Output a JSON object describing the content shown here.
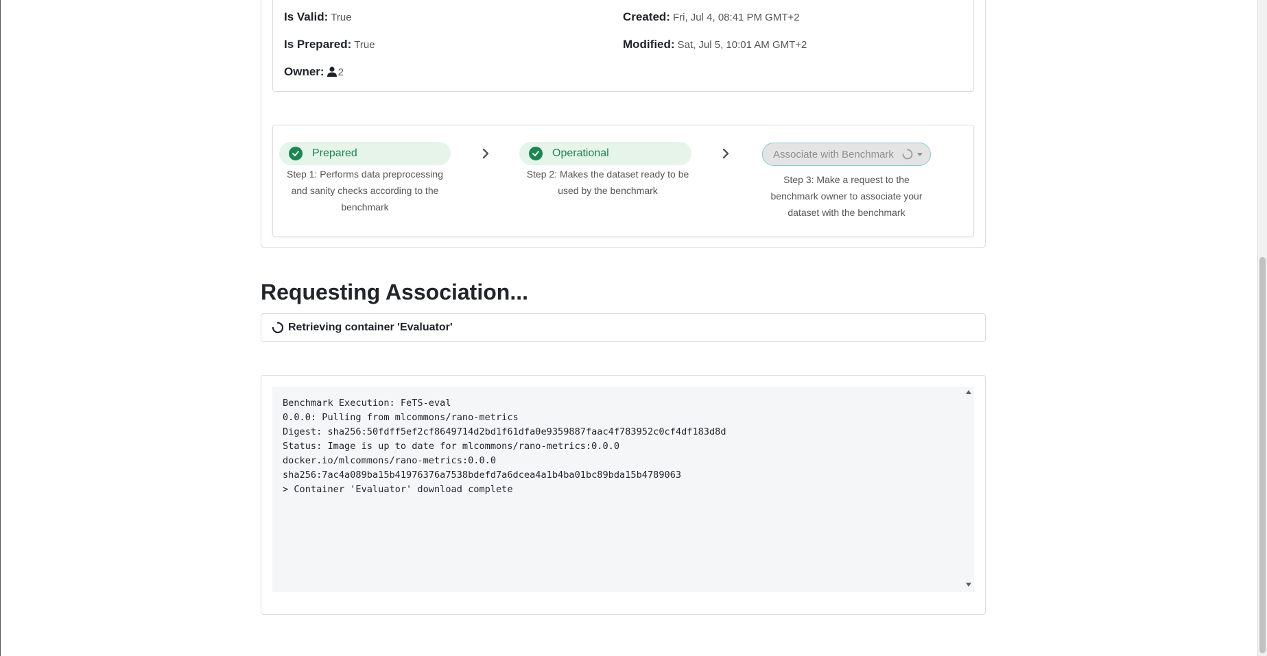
{
  "info": {
    "is_valid_label": "Is Valid:",
    "is_valid_value": "True",
    "is_prepared_label": "Is Prepared:",
    "is_prepared_value": "True",
    "owner_label": "Owner:",
    "owner_value": "2",
    "created_label": "Created:",
    "created_value": "Fri, Jul 4, 08:41 PM GMT+2",
    "modified_label": "Modified:",
    "modified_value": "Sat, Jul 5, 10:01 AM GMT+2"
  },
  "steps": [
    {
      "label": "Prepared",
      "description": "Step 1: Performs data preprocessing and sanity checks according to the benchmark",
      "state": "done"
    },
    {
      "label": "Operational",
      "description": "Step 2: Makes the dataset ready to be used by the benchmark",
      "state": "done"
    },
    {
      "label": "Associate with Benchmark",
      "description": "Step 3: Make a request to the benchmark owner to associate your dataset with the benchmark",
      "state": "in-progress"
    }
  ],
  "section_title": "Requesting Association...",
  "status_text": "Retrieving container 'Evaluator'",
  "log_text": "Benchmark Execution: FeTS-eval\n0.0.0: Pulling from mlcommons/rano-metrics\nDigest: sha256:50fdff5ef2cf8649714d2bd1f61dfa0e9359887faac4f783952c0cf4df183d8d\nStatus: Image is up to date for mlcommons/rano-metrics:0.0.0\ndocker.io/mlcommons/rano-metrics:0.0.0\nsha256:7ac4a089ba15b41976376a7538bdefd7a6dcea4a1b4ba01bc89bda15b4789063\n> Container 'Evaluator' download complete",
  "colors": {
    "success": "#198754",
    "success_bg": "#e6f4ea",
    "disabled_bg": "#e4e4e4",
    "disabled_border": "#7fcbd8",
    "log_bg": "#f5f6f7"
  }
}
